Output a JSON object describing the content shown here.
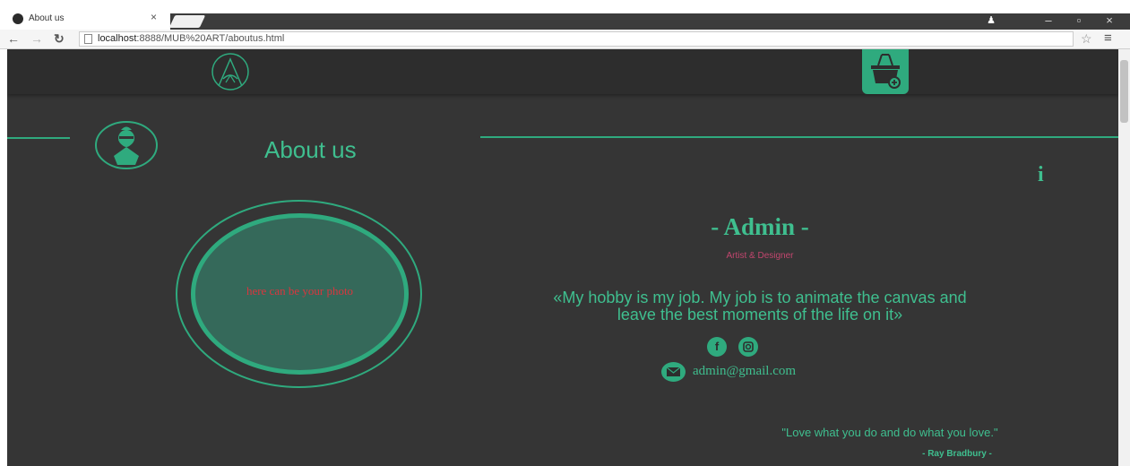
{
  "browser": {
    "tab_title": "About us",
    "tab_close": "×",
    "url_host": "localhost",
    "url_rest": ":8888/MUB%20ART/aboutus.html",
    "window_controls": {
      "minimize": "–",
      "restore": "▫",
      "close": "×"
    }
  },
  "navbar": {
    "logo_icon": "mub-art-logo-icon",
    "cart_icon": "basket-add-icon"
  },
  "about": {
    "title": "About us",
    "icon": "bearded-man-avatar-icon",
    "info_label": "i"
  },
  "photo": {
    "placeholder": "here can be your photo"
  },
  "profile": {
    "name": "- Admin -",
    "role": "Artist & Designer",
    "quote_line1": "«My hobby is my job. My job is to animate the canvas and",
    "quote_line2": "leave the best moments of the life on it»",
    "facebook": "f",
    "email": "admin@gmail.com"
  },
  "footer_quote": {
    "text": "\"Love what you do and do what you love.\"",
    "author": "- Ray Bradbury -"
  },
  "colors": {
    "accent": "#2faa7e",
    "text_green": "#3fbf8f",
    "background": "#353535",
    "navbar": "#2d2d2d",
    "role_pink": "#c2466e",
    "photo_red": "#d9363e"
  }
}
